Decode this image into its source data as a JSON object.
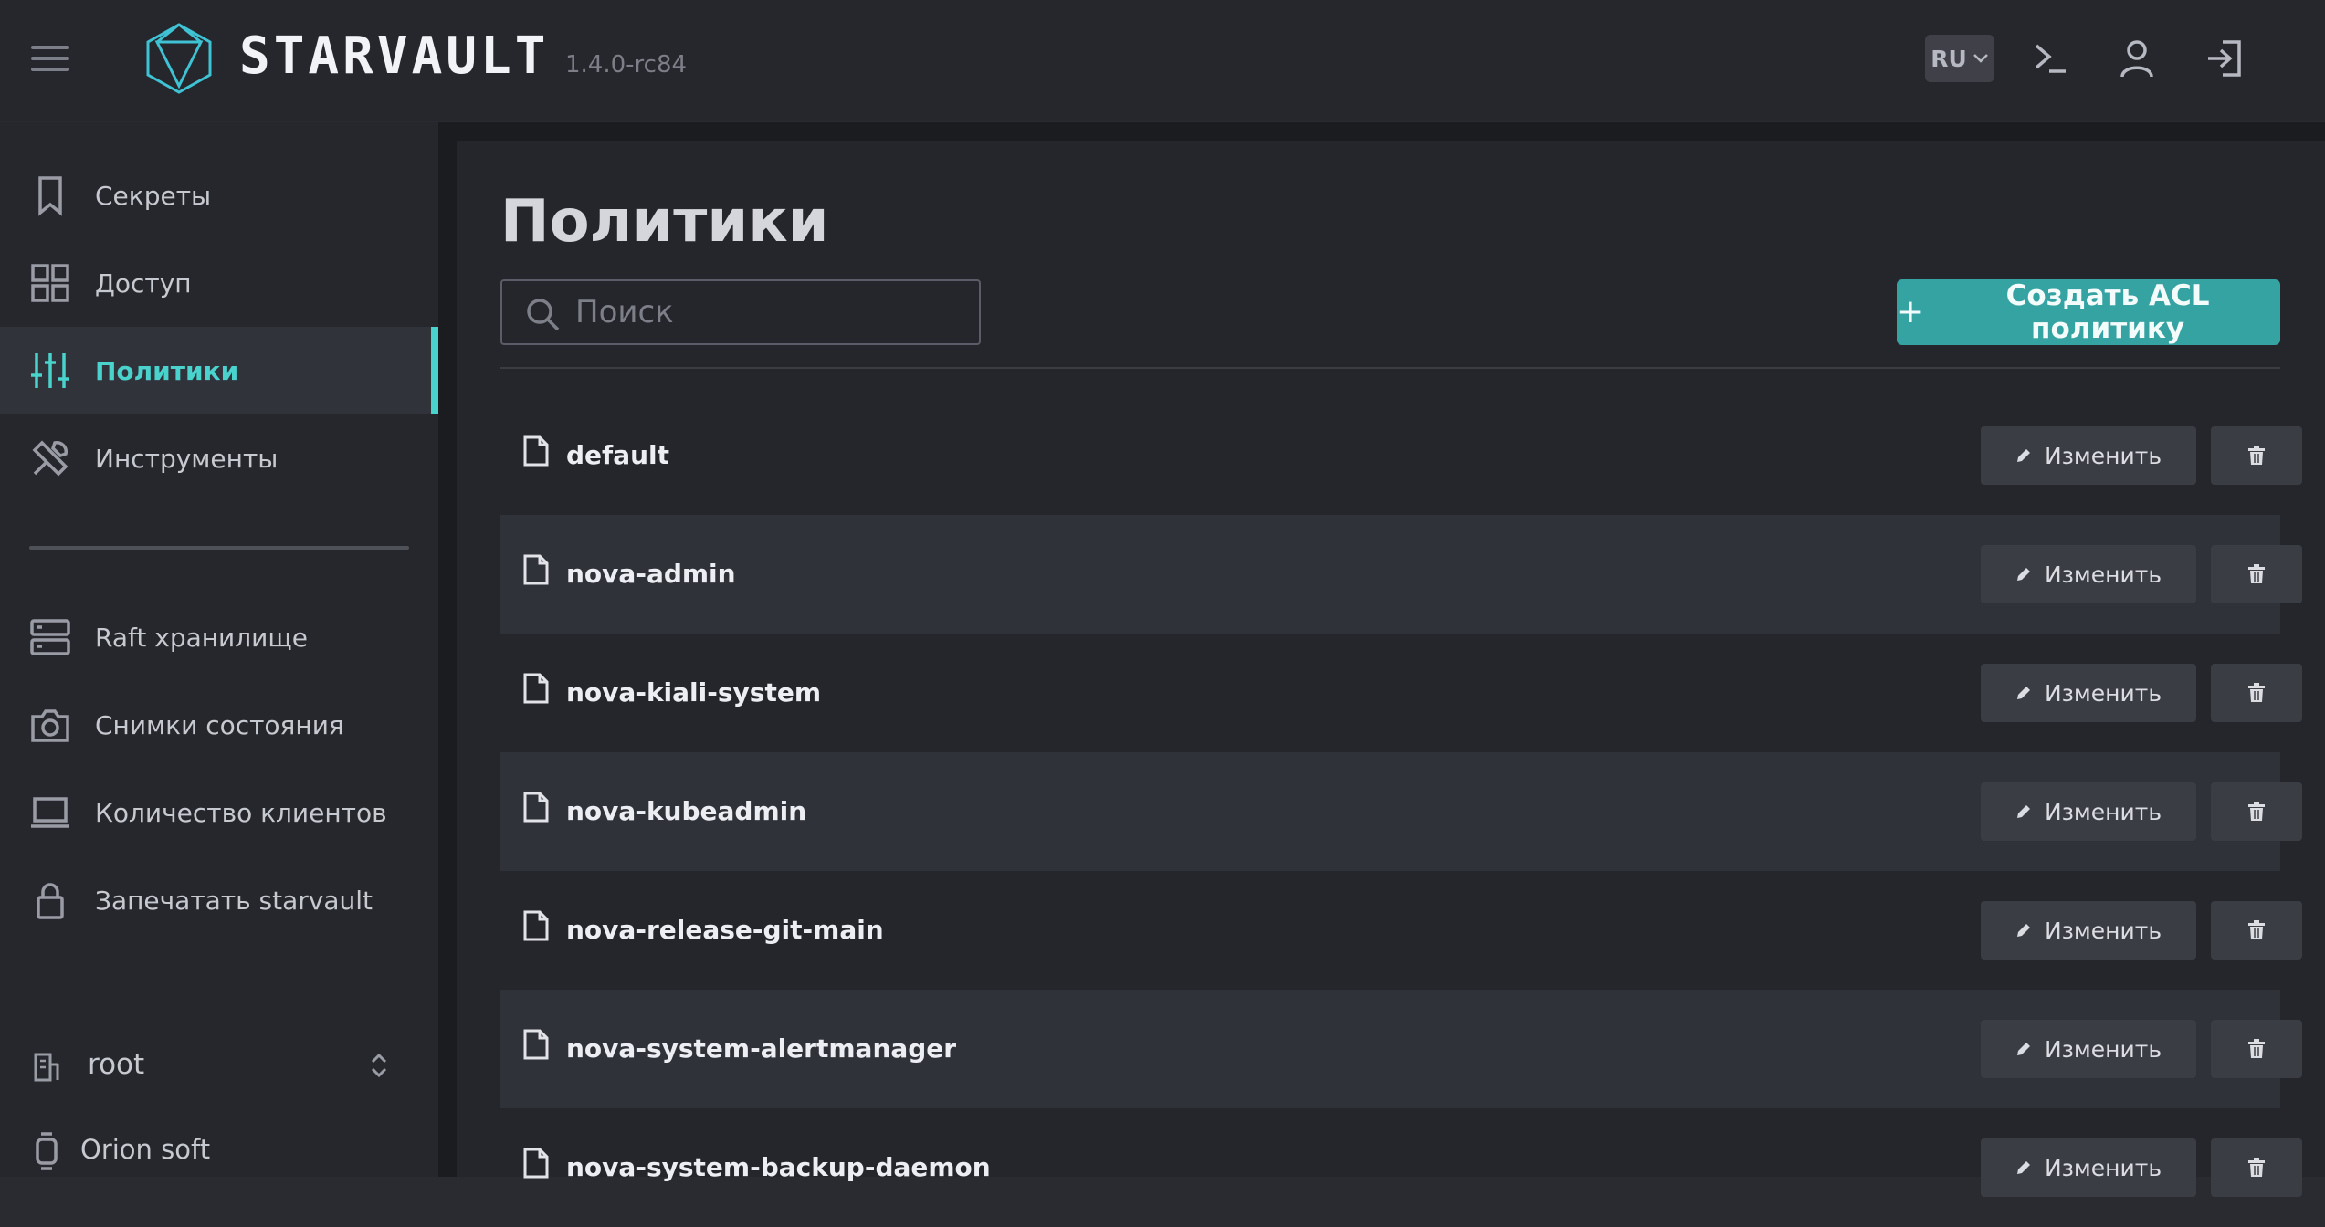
{
  "app": {
    "brand": "STARVAULT",
    "version": "1.4.0-rc84",
    "accent_color": "#4ad2cc",
    "language": "RU"
  },
  "header_icons": [
    "terminal-icon",
    "user-icon",
    "logout-icon"
  ],
  "sidebar": {
    "items": [
      {
        "label": "Секреты",
        "icon": "bookmark-icon"
      },
      {
        "label": "Доступ",
        "icon": "grid-icon"
      },
      {
        "label": "Политики",
        "icon": "sliders-icon",
        "active": true
      },
      {
        "label": "Инструменты",
        "icon": "tools-icon"
      },
      {
        "label": "Raft хранилище",
        "icon": "server-icon"
      },
      {
        "label": "Снимки состояния",
        "icon": "camera-icon"
      },
      {
        "label": "Количество клиентов",
        "icon": "laptop-icon"
      },
      {
        "label": "Запечатать starvault",
        "icon": "lock-icon"
      }
    ],
    "namespace": "root",
    "organization": "Orion soft"
  },
  "main": {
    "title": "Политики",
    "search": {
      "placeholder": "Поиск",
      "value": ""
    },
    "create_button": "Создать ACL политику",
    "edit_label": "Изменить",
    "policies": [
      "default",
      "nova-admin",
      "nova-kiali-system",
      "nova-kubeadmin",
      "nova-release-git-main",
      "nova-system-alertmanager",
      "nova-system-backup-daemon"
    ]
  }
}
